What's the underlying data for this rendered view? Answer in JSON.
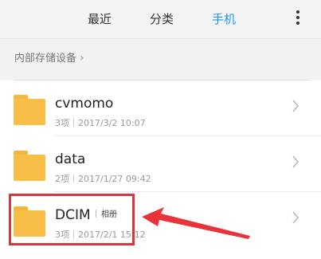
{
  "tabs": {
    "recent": "最近",
    "category": "分类",
    "phone": "手机"
  },
  "more_icon": "more-vertical-icon",
  "breadcrumb": "内部存储设备",
  "files": [
    {
      "name": "cvmomo",
      "count": "3项",
      "date": "2017/3/2 10:07",
      "tag": ""
    },
    {
      "name": "data",
      "count": "2项",
      "date": "2017/1/27 09:42",
      "tag": ""
    },
    {
      "name": "DCIM",
      "count": "3项",
      "date": "2017/2/1 15:12",
      "tag": "相册"
    }
  ],
  "colors": {
    "active_tab": "#2196f3",
    "folder": "#f9be48",
    "highlight": "#d9363e"
  }
}
